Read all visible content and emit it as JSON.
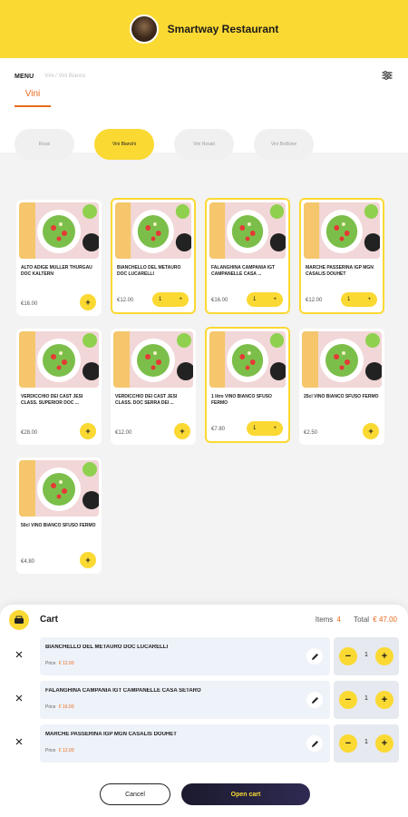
{
  "header": {
    "restaurant_name": "Smartway Restaurant"
  },
  "nav": {
    "menu_label": "MENU",
    "breadcrumb": "Vini / Vini Bianco",
    "active_tab": "Vini"
  },
  "categories": [
    {
      "label": "Rossi",
      "active": false
    },
    {
      "label": "Vini Bianchi",
      "active": true
    },
    {
      "label": "Vini Rosati",
      "active": false
    },
    {
      "label": "Vini Bollicine",
      "active": false
    }
  ],
  "products": [
    {
      "name": "ALTO ADIGE MULLER THURGAU DOC KALTERN",
      "price": "€16.00",
      "qty": null
    },
    {
      "name": "BIANCHELLO DEL METAURO DOC LUCARELLI",
      "price": "€12.00",
      "qty": "1"
    },
    {
      "name": "FALANGHINA CAMPANIA IGT CAMPANELLE CASA ...",
      "price": "€16.00",
      "qty": "1"
    },
    {
      "name": "MARCHE PASSERINA IGP MGN CASALIS DOUHET",
      "price": "€12.00",
      "qty": "1"
    },
    {
      "name": "VERDICCHIO DEI CAST JESI CLASS. SUPERIOR DOC ...",
      "price": "€28.00",
      "qty": null
    },
    {
      "name": "VERDICCHIO DEI CAST JESI CLASS. DOC SERRA DEI ...",
      "price": "€12.00",
      "qty": null
    },
    {
      "name": "1 litro VINO BIANCO SFUSO FERMO",
      "price": "€7.80",
      "qty": "1"
    },
    {
      "name": "25cl VINO BIANCO SFUSO FERMO",
      "price": "€2.50",
      "qty": null
    },
    {
      "name": "50cl VINO BIANCO SFUSO FERMO",
      "price": "€4.80",
      "qty": null
    }
  ],
  "cart": {
    "title": "Cart",
    "items_label": "Items",
    "items_count": "4",
    "total_label": "Total",
    "total_value": "€ 47.00",
    "price_label": "Price",
    "rows": [
      {
        "name": "BIANCHELLO DEL METAURO DOC LUCARELLI",
        "price": "€ 12.00",
        "qty": "1"
      },
      {
        "name": "FALANGHINA CAMPANIA IGT CAMPANELLE CASA SETARO",
        "price": "€ 16.00",
        "qty": "1"
      },
      {
        "name": "MARCHE PASSERINA IGP MGN CASALIS DOUHET",
        "price": "€ 12.00",
        "qty": "1"
      }
    ]
  },
  "footer": {
    "cancel_label": "Cancel",
    "open_cart_label": "Open cart"
  },
  "colors": {
    "accent": "#fbd933",
    "price_accent": "#e86b1d",
    "primary_dark": "#1b1a2e"
  },
  "icons": [
    "restaurant-logo",
    "filter-icon",
    "cart-icon",
    "close-icon",
    "pencil-icon",
    "plus-icon",
    "minus-icon"
  ]
}
